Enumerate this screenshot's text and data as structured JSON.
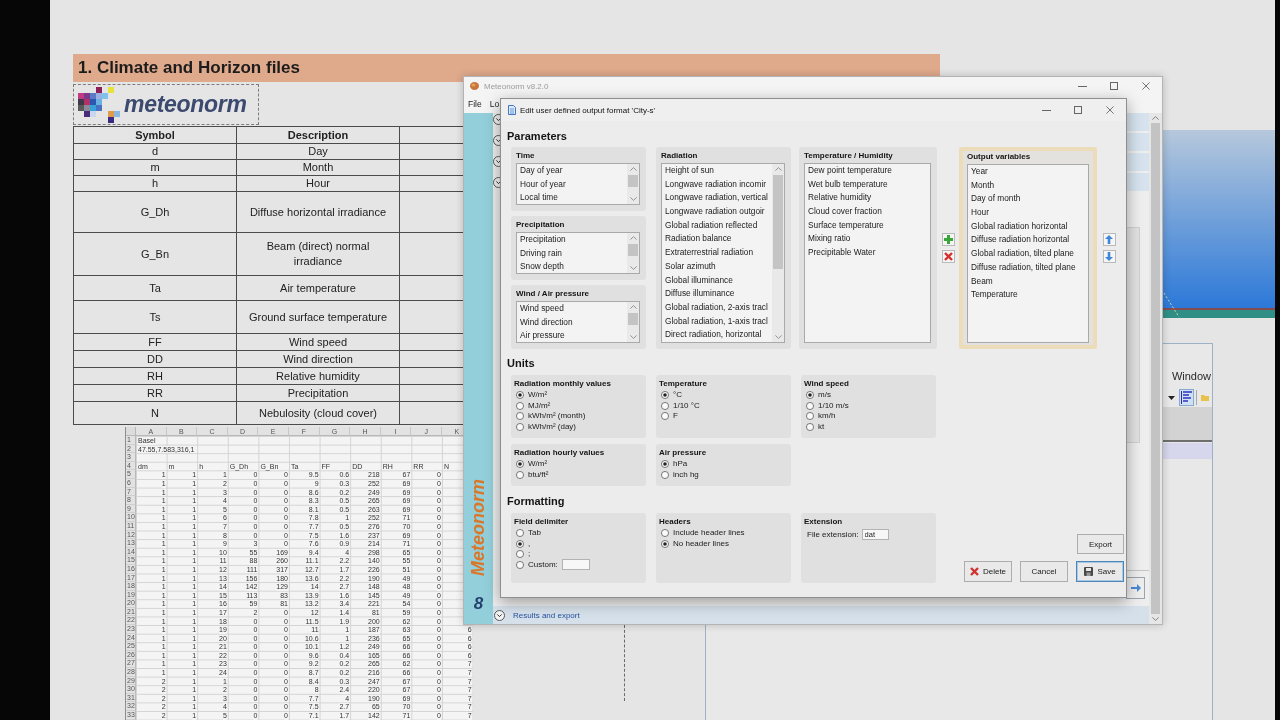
{
  "slide": {
    "title": "1. Climate and Horizon files",
    "logo": {
      "text": "meteonorm"
    },
    "table": {
      "columns": [
        "Symbol",
        "Description"
      ],
      "rows": [
        {
          "symbol": "d",
          "description": "Day"
        },
        {
          "symbol": "m",
          "description": "Month"
        },
        {
          "symbol": "h",
          "description": "Hour"
        },
        {
          "symbol": "G_Dh",
          "description": "Diffuse horizontal irradiance"
        },
        {
          "symbol": "G_Bn",
          "description": "Beam (direct) normal irradiance"
        },
        {
          "symbol": "Ta",
          "description": "Air temperature"
        },
        {
          "symbol": "Ts",
          "description": "Ground surface temperature"
        },
        {
          "symbol": "FF",
          "description": "Wind speed"
        },
        {
          "symbol": "DD",
          "description": "Wind direction"
        },
        {
          "symbol": "RH",
          "description": "Relative humidity"
        },
        {
          "symbol": "RR",
          "description": "Precipitation"
        },
        {
          "symbol": "N",
          "description": "Nebulosity (cloud cover)"
        }
      ]
    },
    "spreadsheet": {
      "columns": [
        "A",
        "B",
        "C",
        "D",
        "E",
        "F",
        "G",
        "H",
        "I",
        "J",
        "K"
      ],
      "rows": [
        {
          "number": "1",
          "kind": "text",
          "cells": [
            "Basel"
          ]
        },
        {
          "number": "2",
          "kind": "text",
          "cells": [
            "47.55,7.583,316,1"
          ]
        },
        {
          "number": "3",
          "kind": "text"
        },
        {
          "number": "4",
          "kind": "text",
          "cells": [
            "dm",
            "m",
            "h",
            "G_Dh",
            "G_Bn",
            "Ta",
            "FF",
            "DD",
            "RH",
            "RR",
            "N"
          ]
        },
        {
          "number": "5",
          "kind": "data",
          "cells": [
            "1",
            "1",
            "1",
            "0",
            "0",
            "9.5",
            "0.6",
            "218",
            "67",
            "0"
          ]
        },
        {
          "number": "6",
          "kind": "data",
          "cells": [
            "1",
            "1",
            "2",
            "0",
            "0",
            "9",
            "0.3",
            "252",
            "69",
            "0"
          ]
        },
        {
          "number": "7",
          "kind": "data",
          "cells": [
            "1",
            "1",
            "3",
            "0",
            "0",
            "8.6",
            "0.2",
            "249",
            "69",
            "0"
          ]
        },
        {
          "number": "8",
          "kind": "data",
          "cells": [
            "1",
            "1",
            "4",
            "0",
            "0",
            "8.3",
            "0.5",
            "265",
            "69",
            "0"
          ]
        },
        {
          "number": "9",
          "kind": "data",
          "cells": [
            "1",
            "1",
            "5",
            "0",
            "0",
            "8.1",
            "0.5",
            "263",
            "69",
            "0"
          ]
        },
        {
          "number": "10",
          "kind": "data",
          "cells": [
            "1",
            "1",
            "6",
            "0",
            "0",
            "7.8",
            "1",
            "252",
            "71",
            "0"
          ]
        },
        {
          "number": "11",
          "kind": "data",
          "cells": [
            "1",
            "1",
            "7",
            "0",
            "0",
            "7.7",
            "0.5",
            "276",
            "70",
            "0"
          ]
        },
        {
          "number": "12",
          "kind": "data",
          "cells": [
            "1",
            "1",
            "8",
            "0",
            "0",
            "7.5",
            "1.6",
            "237",
            "69",
            "0"
          ]
        },
        {
          "number": "13",
          "kind": "data",
          "cells": [
            "1",
            "1",
            "9",
            "3",
            "0",
            "7.6",
            "0.9",
            "214",
            "71",
            "0"
          ]
        },
        {
          "number": "14",
          "kind": "data",
          "cells": [
            "1",
            "1",
            "10",
            "55",
            "169",
            "9.4",
            "4",
            "298",
            "65",
            "0"
          ]
        },
        {
          "number": "15",
          "kind": "data",
          "cells": [
            "1",
            "1",
            "11",
            "88",
            "260",
            "11.1",
            "2.2",
            "140",
            "55",
            "0"
          ]
        },
        {
          "number": "16",
          "kind": "data",
          "cells": [
            "1",
            "1",
            "12",
            "111",
            "317",
            "12.7",
            "1.7",
            "226",
            "51",
            "0"
          ]
        },
        {
          "number": "17",
          "kind": "data",
          "cells": [
            "1",
            "1",
            "13",
            "156",
            "180",
            "13.6",
            "2.2",
            "190",
            "49",
            "0"
          ]
        },
        {
          "number": "18",
          "kind": "data",
          "cells": [
            "1",
            "1",
            "14",
            "142",
            "129",
            "14",
            "2.7",
            "148",
            "48",
            "0"
          ]
        },
        {
          "number": "19",
          "kind": "data",
          "cells": [
            "1",
            "1",
            "15",
            "113",
            "83",
            "13.9",
            "1.6",
            "145",
            "49",
            "0"
          ]
        },
        {
          "number": "20",
          "kind": "data",
          "cells": [
            "1",
            "1",
            "16",
            "59",
            "81",
            "13.2",
            "3.4",
            "221",
            "54",
            "0"
          ]
        },
        {
          "number": "21",
          "kind": "data",
          "cells": [
            "1",
            "1",
            "17",
            "2",
            "0",
            "12",
            "1.4",
            "81",
            "59",
            "0"
          ]
        },
        {
          "number": "22",
          "kind": "data",
          "cells": [
            "1",
            "1",
            "18",
            "0",
            "0",
            "11.5",
            "1.9",
            "200",
            "62",
            "0"
          ]
        },
        {
          "number": "23",
          "kind": "data",
          "cells": [
            "1",
            "1",
            "19",
            "0",
            "0",
            "11",
            "1",
            "187",
            "63",
            "0",
            "6"
          ]
        },
        {
          "number": "24",
          "kind": "data",
          "cells": [
            "1",
            "1",
            "20",
            "0",
            "0",
            "10.6",
            "1",
            "236",
            "65",
            "0",
            "6"
          ]
        },
        {
          "number": "25",
          "kind": "data",
          "cells": [
            "1",
            "1",
            "21",
            "0",
            "0",
            "10.1",
            "1.2",
            "249",
            "66",
            "0",
            "6"
          ]
        },
        {
          "number": "26",
          "kind": "data",
          "cells": [
            "1",
            "1",
            "22",
            "0",
            "0",
            "9.6",
            "0.4",
            "165",
            "66",
            "0",
            "6"
          ]
        },
        {
          "number": "27",
          "kind": "data",
          "cells": [
            "1",
            "1",
            "23",
            "0",
            "0",
            "9.2",
            "0.2",
            "265",
            "62",
            "0",
            "7"
          ]
        },
        {
          "number": "28",
          "kind": "data",
          "cells": [
            "1",
            "1",
            "24",
            "0",
            "0",
            "8.7",
            "0.2",
            "216",
            "66",
            "0",
            "7"
          ]
        },
        {
          "number": "29",
          "kind": "data",
          "cells": [
            "2",
            "1",
            "1",
            "0",
            "0",
            "8.4",
            "0.3",
            "247",
            "67",
            "0",
            "7"
          ]
        },
        {
          "number": "30",
          "kind": "data",
          "cells": [
            "2",
            "1",
            "2",
            "0",
            "0",
            "8",
            "2.4",
            "220",
            "67",
            "0",
            "7"
          ]
        },
        {
          "number": "31",
          "kind": "data",
          "cells": [
            "2",
            "1",
            "3",
            "0",
            "0",
            "7.7",
            "4",
            "190",
            "69",
            "0",
            "7"
          ]
        },
        {
          "number": "32",
          "kind": "data",
          "cells": [
            "2",
            "1",
            "4",
            "0",
            "0",
            "7.5",
            "2.7",
            "65",
            "70",
            "0",
            "7"
          ]
        },
        {
          "number": "33",
          "kind": "data",
          "cells": [
            "2",
            "1",
            "5",
            "0",
            "0",
            "7.1",
            "1.7",
            "142",
            "71",
            "0",
            "7"
          ]
        }
      ]
    }
  },
  "back_window": {
    "menu": [
      "Window"
    ],
    "tools": [
      {
        "kind": "dropdown",
        "selected": false
      },
      {
        "kind": "align",
        "selected": true
      },
      {
        "kind": "folder",
        "selected": false
      }
    ]
  },
  "meteonorm_window": {
    "title": "Meteonorm v8.2.0",
    "menu": [
      "File",
      "Lo"
    ],
    "brand": "Meteonorm",
    "version": "8",
    "section_toggles": [
      {
        "expanded": false
      },
      {
        "expanded": false
      },
      {
        "expanded": false
      },
      {
        "expanded": false
      }
    ],
    "results_section": {
      "title": "Results and export",
      "expanded": false
    }
  },
  "dialog": {
    "title": "Edit user defined output format 'City-s'",
    "parameters": {
      "heading": "Parameters",
      "sources": [
        {
          "title": "Time",
          "scrollable": true,
          "items": [
            "Day of year",
            "Hour of year",
            "Local time"
          ]
        },
        {
          "title": "Precipitation",
          "scrollable": true,
          "items": [
            "Precipitation",
            "Driving rain",
            "Snow depth"
          ]
        },
        {
          "title": "Wind / Air pressure",
          "scrollable": true,
          "items": [
            "Wind speed",
            "Wind direction",
            "Air pressure"
          ]
        },
        {
          "title": "Radiation",
          "scrollable": true,
          "items": [
            "Height of sun",
            "Longwave radiation incomir",
            "Longwave radiation, vertical",
            "Longwave radiation outgoir",
            "Global radiation reflected",
            "Radiation balance",
            "Extraterrestrial radiation",
            "Solar azimuth",
            "Global illuminance",
            "Diffuse illuminance",
            "Global radiation, 2-axis tracl",
            "Global radiation, 1-axis tracl",
            "Direct radiation, horizontal"
          ]
        },
        {
          "title": "Temperature / Humidity",
          "scrollable": false,
          "items": [
            "Dew point temperature",
            "Wet bulb temperature",
            "Relative humidity",
            "Cloud cover fraction",
            "Surface temperature",
            "Mixing ratio",
            "Precipitable Water"
          ]
        }
      ],
      "output": {
        "title": "Output variables",
        "items": [
          "Year",
          "Month",
          "Day of month",
          "Hour",
          "Global radiation horizontal",
          "Diffuse radiation horizontal",
          "Global radiation, tilted plane",
          "Diffuse radiation, tilted plane",
          "Beam",
          "Temperature"
        ]
      }
    },
    "units": {
      "heading": "Units",
      "groups": [
        {
          "title": "Radiation monthly values",
          "options": [
            {
              "label": "W/m²",
              "selected": true
            },
            {
              "label": "MJ/m²",
              "selected": false
            },
            {
              "label": "kWh/m² (month)",
              "selected": false
            },
            {
              "label": "kWh/m² (day)",
              "selected": false
            }
          ]
        },
        {
          "title": "Temperature",
          "options": [
            {
              "label": "°C",
              "selected": true
            },
            {
              "label": "1/10 °C",
              "selected": false
            },
            {
              "label": "F",
              "selected": false
            }
          ]
        },
        {
          "title": "Wind speed",
          "options": [
            {
              "label": "m/s",
              "selected": true
            },
            {
              "label": "1/10 m/s",
              "selected": false
            },
            {
              "label": "km/h",
              "selected": false
            },
            {
              "label": "kt",
              "selected": false
            }
          ]
        },
        {
          "title": "Radiation hourly values",
          "options": [
            {
              "label": "W/m²",
              "selected": true
            },
            {
              "label": "btu/ft²",
              "selected": false
            }
          ]
        },
        {
          "title": "Air pressure",
          "options": [
            {
              "label": "hPa",
              "selected": true
            },
            {
              "label": "inch hg",
              "selected": false
            }
          ]
        }
      ]
    },
    "formatting": {
      "heading": "Formatting",
      "delimiter": {
        "title": "Field delimiter",
        "options": [
          {
            "label": "Tab",
            "selected": false,
            "kind": "plain"
          },
          {
            "label": ",",
            "selected": true,
            "kind": "plain"
          },
          {
            "label": ";",
            "selected": false,
            "kind": "plain"
          },
          {
            "label": "Custom:",
            "selected": false,
            "kind": "custom"
          }
        ]
      },
      "headers": {
        "title": "Headers",
        "options": [
          {
            "label": "Include header lines",
            "selected": false
          },
          {
            "label": "No header lines",
            "selected": true
          }
        ]
      },
      "extension": {
        "title": "Extension",
        "label": "File extension:",
        "value": "dat"
      }
    },
    "buttons": {
      "export": "Export",
      "actions": [
        {
          "label": "Delete",
          "kind": "delete",
          "focused": false
        },
        {
          "label": "Cancel",
          "kind": "plain",
          "focused": false
        },
        {
          "label": "Save",
          "kind": "save",
          "focused": true
        }
      ]
    }
  }
}
